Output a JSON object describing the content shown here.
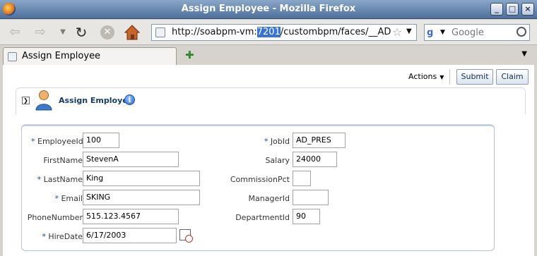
{
  "window": {
    "title": "Assign Employee - Mozilla Firefox",
    "buttons": {
      "minimize": "_",
      "maximize": "□",
      "close": "×"
    }
  },
  "navbar": {
    "url_prefix": "http://soabpm-vm:",
    "url_selected": "7201",
    "url_suffix": "/custombpm/faces/__AD",
    "search_placeholder": "Google"
  },
  "tab": {
    "label": "Assign Employee"
  },
  "toolbar": {
    "actions_label": "Actions",
    "submit_label": "Submit",
    "claim_label": "Claim"
  },
  "panel": {
    "title": "Assign Employee"
  },
  "form": {
    "required_marker": "*",
    "left": [
      {
        "label": "EmployeeId",
        "required": true,
        "value": "100"
      },
      {
        "label": "FirstName",
        "required": false,
        "value": "StevenA"
      },
      {
        "label": "LastName",
        "required": true,
        "value": "King"
      },
      {
        "label": "Email",
        "required": true,
        "value": "SKING"
      },
      {
        "label": "PhoneNumber",
        "required": false,
        "value": "515.123.4567"
      },
      {
        "label": "HireDate",
        "required": true,
        "value": "6/17/2003"
      }
    ],
    "right": [
      {
        "label": "JobId",
        "required": true,
        "value": "AD_PRES"
      },
      {
        "label": "Salary",
        "required": false,
        "value": "24000"
      },
      {
        "label": "CommissionPct",
        "required": false,
        "value": ""
      },
      {
        "label": "ManagerId",
        "required": false,
        "value": ""
      },
      {
        "label": "DepartmentId",
        "required": false,
        "value": "90"
      }
    ]
  },
  "icons": {
    "firefox": "firefox-icon",
    "back": "back-arrow-icon",
    "forward": "forward-arrow-icon",
    "reload": "reload-icon",
    "stop": "stop-icon",
    "home": "home-icon",
    "user": "user-icon",
    "info": "info-icon",
    "calendar": "calendar-icon"
  }
}
